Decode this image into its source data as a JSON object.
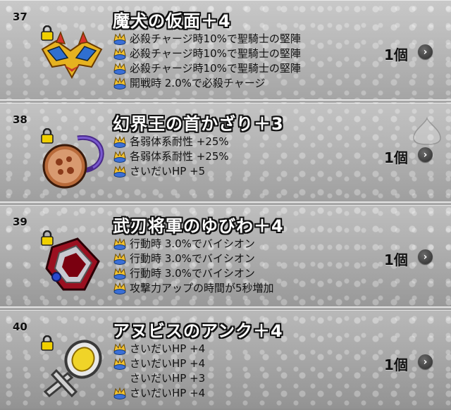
{
  "items": [
    {
      "number": "37",
      "name": "魔犬の仮面＋4",
      "quantity": "1個",
      "effects": [
        {
          "icon": "crown-icon",
          "text": "必殺チャージ時10%で聖騎士の堅陣"
        },
        {
          "icon": "crown-icon",
          "text": "必殺チャージ時10%で聖騎士の堅陣"
        },
        {
          "icon": "crown-icon",
          "text": "必殺チャージ時10%で聖騎士の堅陣"
        },
        {
          "icon": "crown-icon",
          "text": "開戦時 2.0%で必殺チャージ"
        }
      ],
      "art": "mask"
    },
    {
      "number": "38",
      "name": "幻界王の首かざり＋3",
      "quantity": "1個",
      "effects": [
        {
          "icon": "crown-icon",
          "text": "各弱体系耐性 +25%"
        },
        {
          "icon": "crown-icon",
          "text": "各弱体系耐性 +25%"
        },
        {
          "icon": "crown-icon",
          "text": "さいだいHP +5"
        }
      ],
      "art": "necklace"
    },
    {
      "number": "39",
      "name": "武刃将軍のゆびわ＋4",
      "quantity": "1個",
      "effects": [
        {
          "icon": "crown-icon",
          "text": "行動時 3.0%でバイシオン"
        },
        {
          "icon": "crown-icon",
          "text": "行動時 3.0%でバイシオン"
        },
        {
          "icon": "crown-icon",
          "text": "行動時 3.0%でバイシオン"
        },
        {
          "icon": "crown-icon",
          "text": "攻撃力アップの時間が5秒増加"
        }
      ],
      "art": "ring"
    },
    {
      "number": "40",
      "name": "アヌビスのアンク＋4",
      "quantity": "1個",
      "effects": [
        {
          "icon": "crown-icon",
          "text": "さいだいHP +4"
        },
        {
          "icon": "crown-icon",
          "text": "さいだいHP +4"
        },
        {
          "icon": "",
          "text": "さいだいHP +3"
        },
        {
          "icon": "crown-icon",
          "text": "さいだいHP +4"
        }
      ],
      "art": "ankh"
    }
  ],
  "colors": {
    "crown_gold": "#f2c230",
    "crown_blue": "#3b6fd6",
    "lock_gold": "#f0d000"
  }
}
